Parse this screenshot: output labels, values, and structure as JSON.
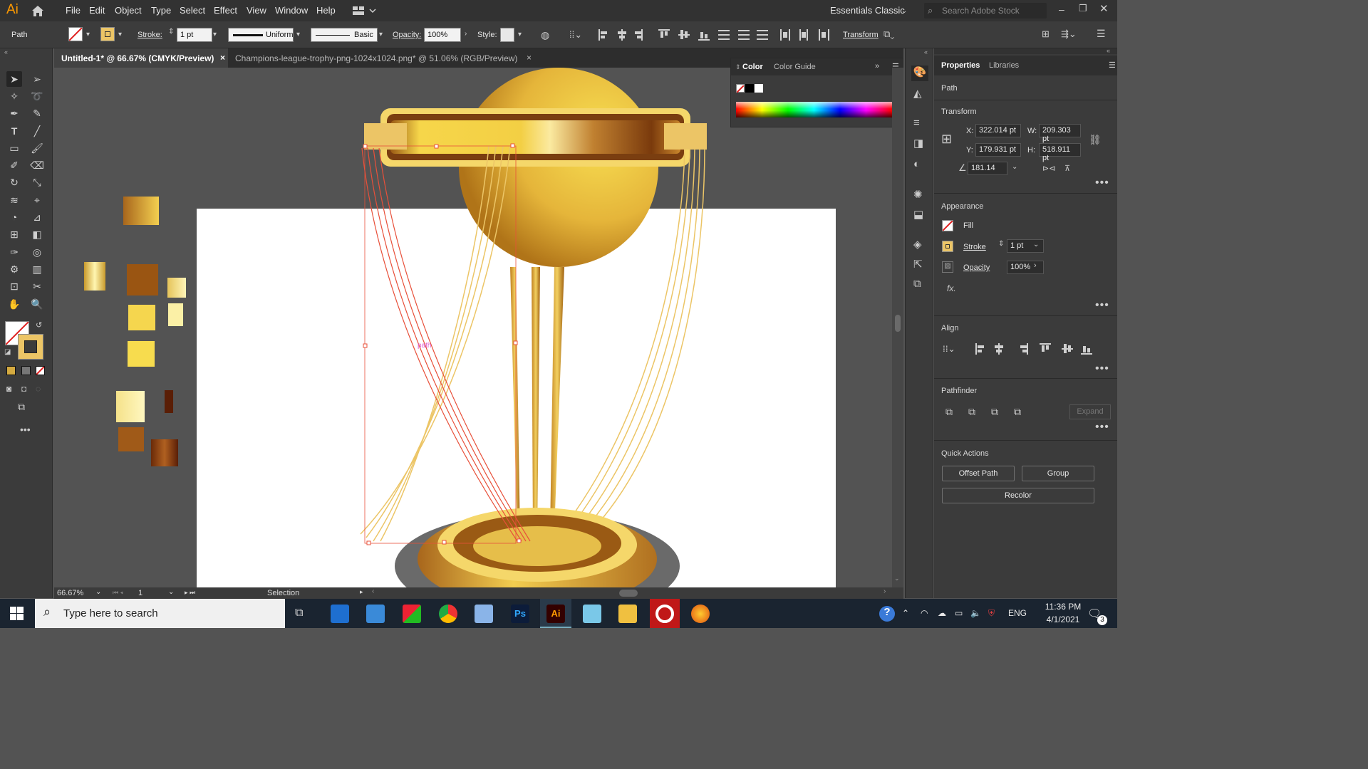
{
  "app": {
    "logo": "Ai"
  },
  "menubar": {
    "items": [
      "File",
      "Edit",
      "Object",
      "Type",
      "Select",
      "Effect",
      "View",
      "Window",
      "Help"
    ],
    "workspace": "Essentials Classic",
    "search_placeholder": "Search Adobe Stock"
  },
  "control": {
    "object_type": "Path",
    "stroke_label": "Stroke:",
    "stroke_value": "1 pt",
    "profile1": "Uniform",
    "profile2": "Basic",
    "opacity_label": "Opacity:",
    "opacity_value": "100%",
    "style_label": "Style:",
    "transform_label": "Transform"
  },
  "tabs": [
    {
      "label": "Untitled-1* @ 66.67% (CMYK/Preview)",
      "close": "×"
    },
    {
      "label": "Champions-league-trophy-png-1024x1024.png* @ 51.06% (RGB/Preview)",
      "close": "×"
    }
  ],
  "color_panel": {
    "tabs": [
      "Color",
      "Color Guide"
    ]
  },
  "properties": {
    "tabs": [
      "Properties",
      "Libraries"
    ],
    "selection_type": "Path",
    "transform_title": "Transform",
    "x_label": "X:",
    "x_value": "322.014 pt",
    "y_label": "Y:",
    "y_value": "179.931 pt",
    "w_label": "W:",
    "w_value": "209.303 pt",
    "h_label": "H:",
    "h_value": "518.911 pt",
    "angle_value": "181.14",
    "appearance_title": "Appearance",
    "fill_label": "Fill",
    "stroke_label": "Stroke",
    "stroke_value": "1 pt",
    "opacity_label": "Opacity",
    "opacity_value": "100%",
    "fx_label": "fx.",
    "align_title": "Align",
    "pathfinder_title": "Pathfinder",
    "expand_label": "Expand",
    "quick_actions_title": "Quick Actions",
    "offset_path_label": "Offset Path",
    "group_label": "Group",
    "recolor_label": "Recolor"
  },
  "canvas": {
    "path_hint": "path"
  },
  "status": {
    "zoom": "66.67%",
    "artboard": "1",
    "tool": "Selection"
  },
  "taskbar": {
    "search_placeholder": "Type here to search",
    "lang": "ENG",
    "time": "11:36 PM",
    "date": "4/1/2021",
    "notif_count": "3"
  },
  "colors": {
    "accent": "#ff9a00",
    "selection": "#e8503a",
    "gold_light": "#f7e07a",
    "gold": "#e8b83c",
    "gold_dark": "#8a4a10"
  }
}
